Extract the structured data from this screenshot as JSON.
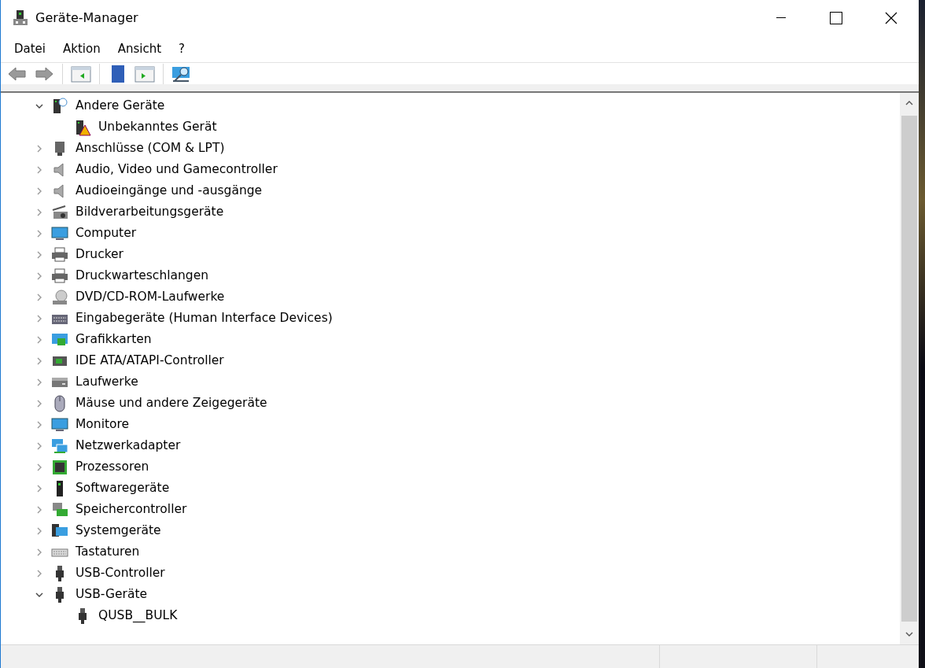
{
  "window": {
    "title": "Geräte-Manager"
  },
  "menu": [
    "Datei",
    "Aktion",
    "Ansicht",
    "?"
  ],
  "tree": [
    {
      "label": "Andere Geräte",
      "expanded": true,
      "children": [
        {
          "label": "Unbekanntes Gerät"
        }
      ]
    },
    {
      "label": "Anschlüsse (COM & LPT)",
      "expanded": false
    },
    {
      "label": "Audio, Video und Gamecontroller",
      "expanded": false
    },
    {
      "label": "Audioeingänge und -ausgänge",
      "expanded": false
    },
    {
      "label": "Bildverarbeitungsgeräte",
      "expanded": false
    },
    {
      "label": "Computer",
      "expanded": false
    },
    {
      "label": "Drucker",
      "expanded": false
    },
    {
      "label": "Druckwarteschlangen",
      "expanded": false
    },
    {
      "label": "DVD/CD-ROM-Laufwerke",
      "expanded": false
    },
    {
      "label": "Eingabegeräte (Human Interface Devices)",
      "expanded": false
    },
    {
      "label": "Grafikkarten",
      "expanded": false
    },
    {
      "label": "IDE ATA/ATAPI-Controller",
      "expanded": false
    },
    {
      "label": "Laufwerke",
      "expanded": false
    },
    {
      "label": "Mäuse und andere Zeigegeräte",
      "expanded": false
    },
    {
      "label": "Monitore",
      "expanded": false
    },
    {
      "label": "Netzwerkadapter",
      "expanded": false
    },
    {
      "label": "Prozessoren",
      "expanded": false
    },
    {
      "label": "Softwaregeräte",
      "expanded": false
    },
    {
      "label": "Speichercontroller",
      "expanded": false
    },
    {
      "label": "Systemgeräte",
      "expanded": false
    },
    {
      "label": "Tastaturen",
      "expanded": false
    },
    {
      "label": "USB-Controller",
      "expanded": false
    },
    {
      "label": "USB-Geräte",
      "expanded": true,
      "children": [
        {
          "label": "QUSB__BULK"
        }
      ]
    }
  ]
}
